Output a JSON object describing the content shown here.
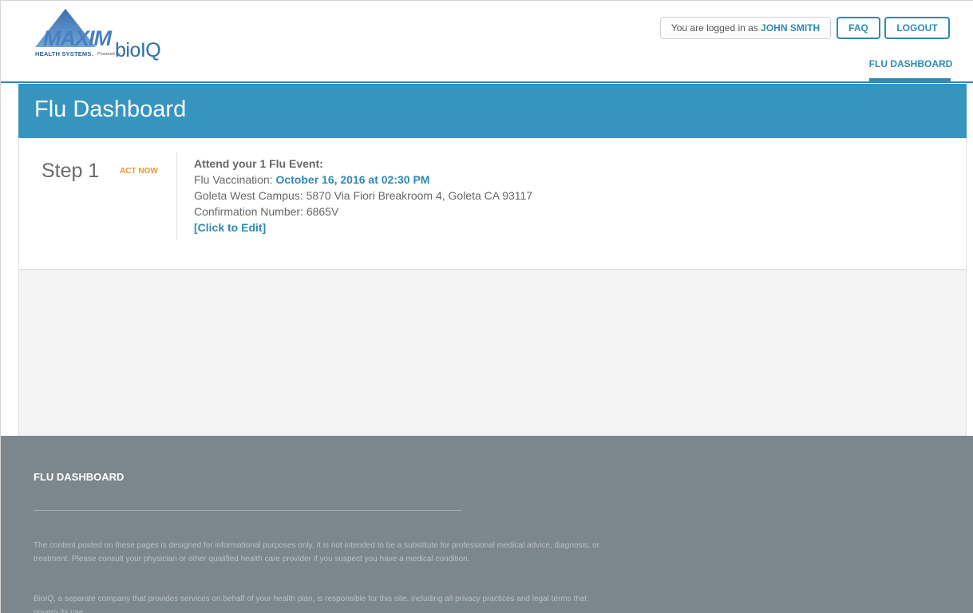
{
  "header": {
    "logo": {
      "brand": "MAXIM",
      "tagline": "HEALTH SYSTEMS.",
      "powered_by": "Powered by",
      "partner": "bioIQ"
    },
    "user_prefix": "You are logged in as ",
    "user_name": "JOHN SMITH",
    "faq_label": "FAQ",
    "logout_label": "LOGOUT",
    "nav_tab": "FLU DASHBOARD"
  },
  "page": {
    "title": "Flu Dashboard"
  },
  "step": {
    "label": "Step 1",
    "badge": "ACT NOW",
    "heading": "Attend your 1 Flu Event:",
    "vaccination_prefix": "Flu Vaccination: ",
    "vaccination_date": "October 16, 2016 at 02:30 PM",
    "location": "Goleta West Campus: 5870 Via Fiori Breakroom 4, Goleta CA 93117",
    "confirmation": "Confirmation Number: 6865V",
    "edit_label": "[Click to Edit]"
  },
  "footer": {
    "title": "FLU DASHBOARD",
    "paragraph1": "The content posted on these pages is designed for informational purposes only. It is not intended to be a substitute for professional medical advice, diagnosis, or treatment. Please consult your physician or other qualified health care provider if you suspect you have a medical condition.",
    "paragraph2": "BioIQ, a separate company that provides services on behalf of your health plan, is responsible for this site, including all privacy practices and legal terms that govern its use."
  },
  "colors": {
    "primary": "#2f8ab5",
    "banner": "#3595bf",
    "accent": "#e8962e",
    "footer": "#7b878c"
  }
}
